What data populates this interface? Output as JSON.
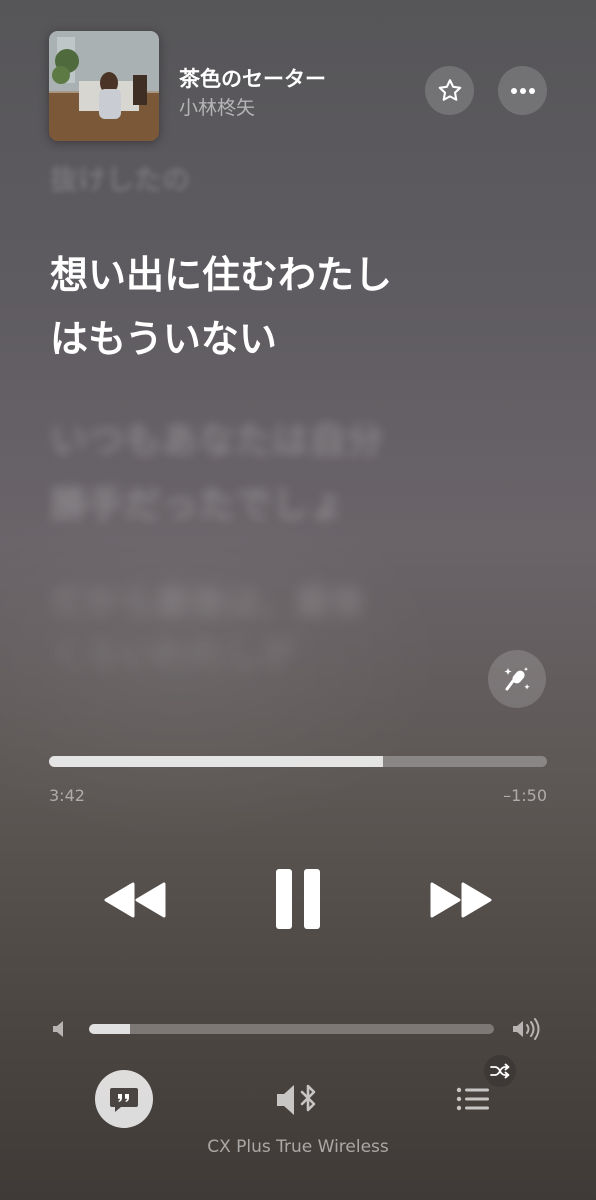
{
  "now_playing": {
    "title": "茶色のセーター",
    "artist": "小林柊矢"
  },
  "lyrics": {
    "previous": "抜けしたの",
    "active": [
      "想い出に住むわたし",
      "はもういない"
    ],
    "upcoming": [
      "いつもあなたは自分",
      "勝手だったでしょ",
      "だから最後は、最後",
      "くらいわたしが"
    ]
  },
  "playback": {
    "elapsed": "3:42",
    "remaining": "–1:50",
    "progress": 0.67
  },
  "volume": {
    "level": 0.1
  },
  "output": {
    "device_name": "CX Plus True Wireless"
  },
  "icons": {
    "favorite": "star-icon",
    "more": "ellipsis-icon",
    "sing": "microphone-sparkle-icon",
    "rewind": "rewind-icon",
    "pause": "pause-icon",
    "forward": "fast-forward-icon",
    "volume_low": "speaker-low-icon",
    "volume_high": "speaker-high-icon",
    "lyrics": "quote-bubble-icon",
    "output": "bluetooth-speaker-icon",
    "queue": "list-icon",
    "shuffle": "shuffle-icon"
  }
}
